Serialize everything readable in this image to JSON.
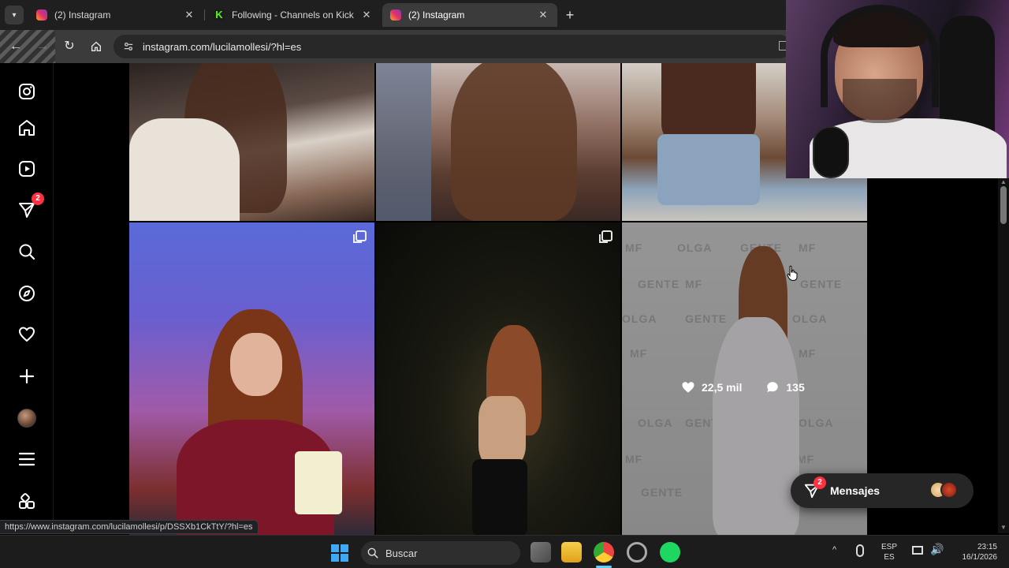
{
  "browser": {
    "tabs": [
      {
        "title": "(2) Instagram",
        "favicon": "instagram-icon",
        "active": false
      },
      {
        "title": "Following - Channels on Kick",
        "favicon": "kick-icon",
        "active": false
      },
      {
        "title": "(2) Instagram",
        "favicon": "instagram-icon",
        "active": true
      }
    ],
    "url": "instagram.com/lucilamollesi/?hl=es",
    "status_url": "https://www.instagram.com/lucilamollesi/p/DSSXb1CkTtY/?hl=es"
  },
  "sidebar": {
    "items": [
      {
        "name": "instagram-logo-icon"
      },
      {
        "name": "home-icon"
      },
      {
        "name": "reels-icon"
      },
      {
        "name": "messages-icon",
        "badge": "2"
      },
      {
        "name": "search-icon"
      },
      {
        "name": "explore-icon"
      },
      {
        "name": "notifications-icon"
      },
      {
        "name": "create-icon"
      },
      {
        "name": "profile-avatar"
      },
      {
        "name": "more-menu-icon"
      },
      {
        "name": "also-from-meta-icon"
      }
    ]
  },
  "grid": {
    "hover_post": {
      "likes": "22,5 mil",
      "comments": "135"
    },
    "backdrop_words": [
      "MF",
      "OLGA",
      "GENTE"
    ]
  },
  "messages_pill": {
    "label": "Mensajes",
    "badge": "2"
  },
  "taskbar": {
    "search_placeholder": "Buscar",
    "lang_top": "ESP",
    "lang_bottom": "ES",
    "time": "23:15",
    "date": "16/1/2026"
  },
  "colors": {
    "accent": "#60cdff",
    "notification": "#ff3040",
    "kick": "#53fc18"
  }
}
